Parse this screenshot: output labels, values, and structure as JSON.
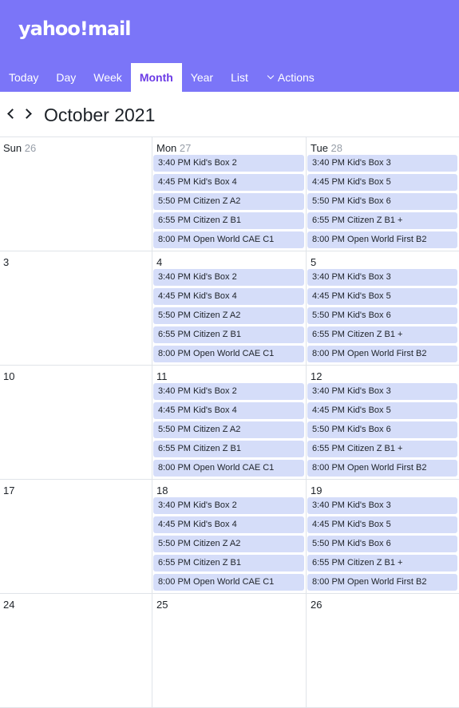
{
  "brand": {
    "logo_text": "yahoo!mail"
  },
  "nav": {
    "tabs": [
      {
        "label": "Today"
      },
      {
        "label": "Day"
      },
      {
        "label": "Week"
      },
      {
        "label": "Month"
      },
      {
        "label": "Year"
      },
      {
        "label": "List"
      }
    ],
    "actions_label": "Actions",
    "active_tab": "Month"
  },
  "toolbar": {
    "month_title": "October 2021"
  },
  "columns": [
    {
      "weekday": "Sun"
    },
    {
      "weekday": "Mon"
    },
    {
      "weekday": "Tue"
    }
  ],
  "weeks": [
    {
      "days": [
        {
          "num": "26",
          "header": "Sun",
          "events": []
        },
        {
          "num": "27",
          "header": "Mon",
          "events": [
            "3:40 PM Kid's Box 2",
            "4:45 PM Kid's Box 4",
            "5:50 PM Citizen Z A2",
            "6:55 PM Citizen Z B1",
            "8:00 PM Open World CAE C1"
          ]
        },
        {
          "num": "28",
          "header": "Tue",
          "events": [
            "3:40 PM Kid's Box 3",
            "4:45 PM Kid's Box 5",
            "5:50 PM Kid's Box 6",
            "6:55 PM Citizen Z B1 +",
            "8:00 PM Open World First B2"
          ]
        }
      ]
    },
    {
      "days": [
        {
          "num": "3",
          "header": "",
          "events": []
        },
        {
          "num": "4",
          "header": "",
          "events": [
            "3:40 PM Kid's Box 2",
            "4:45 PM Kid's Box 4",
            "5:50 PM Citizen Z A2",
            "6:55 PM Citizen Z B1",
            "8:00 PM Open World CAE C1"
          ]
        },
        {
          "num": "5",
          "header": "",
          "events": [
            "3:40 PM Kid's Box 3",
            "4:45 PM Kid's Box 5",
            "5:50 PM Kid's Box 6",
            "6:55 PM Citizen Z B1 +",
            "8:00 PM Open World First B2"
          ]
        }
      ]
    },
    {
      "days": [
        {
          "num": "10",
          "header": "",
          "events": []
        },
        {
          "num": "11",
          "header": "",
          "events": [
            "3:40 PM Kid's Box 2",
            "4:45 PM Kid's Box 4",
            "5:50 PM Citizen Z A2",
            "6:55 PM Citizen Z B1",
            "8:00 PM Open World CAE C1"
          ]
        },
        {
          "num": "12",
          "header": "",
          "events": [
            "3:40 PM Kid's Box 3",
            "4:45 PM Kid's Box 5",
            "5:50 PM Kid's Box 6",
            "6:55 PM Citizen Z B1 +",
            "8:00 PM Open World First B2"
          ]
        }
      ]
    },
    {
      "days": [
        {
          "num": "17",
          "header": "",
          "events": []
        },
        {
          "num": "18",
          "header": "",
          "events": [
            "3:40 PM Kid's Box 2",
            "4:45 PM Kid's Box 4",
            "5:50 PM Citizen Z A2",
            "6:55 PM Citizen Z B1",
            "8:00 PM Open World CAE C1"
          ]
        },
        {
          "num": "19",
          "header": "",
          "events": [
            "3:40 PM Kid's Box 3",
            "4:45 PM Kid's Box 5",
            "5:50 PM Kid's Box 6",
            "6:55 PM Citizen Z B1 +",
            "8:00 PM Open World First B2"
          ]
        }
      ]
    },
    {
      "days": [
        {
          "num": "24",
          "header": "",
          "events": []
        },
        {
          "num": "25",
          "header": "",
          "events": []
        },
        {
          "num": "26",
          "header": "",
          "events": []
        }
      ]
    }
  ],
  "colors": {
    "header_bg": "#7b75f8",
    "active_tab_text": "#6c3ce6",
    "event_bg": "#d5ddf9"
  }
}
